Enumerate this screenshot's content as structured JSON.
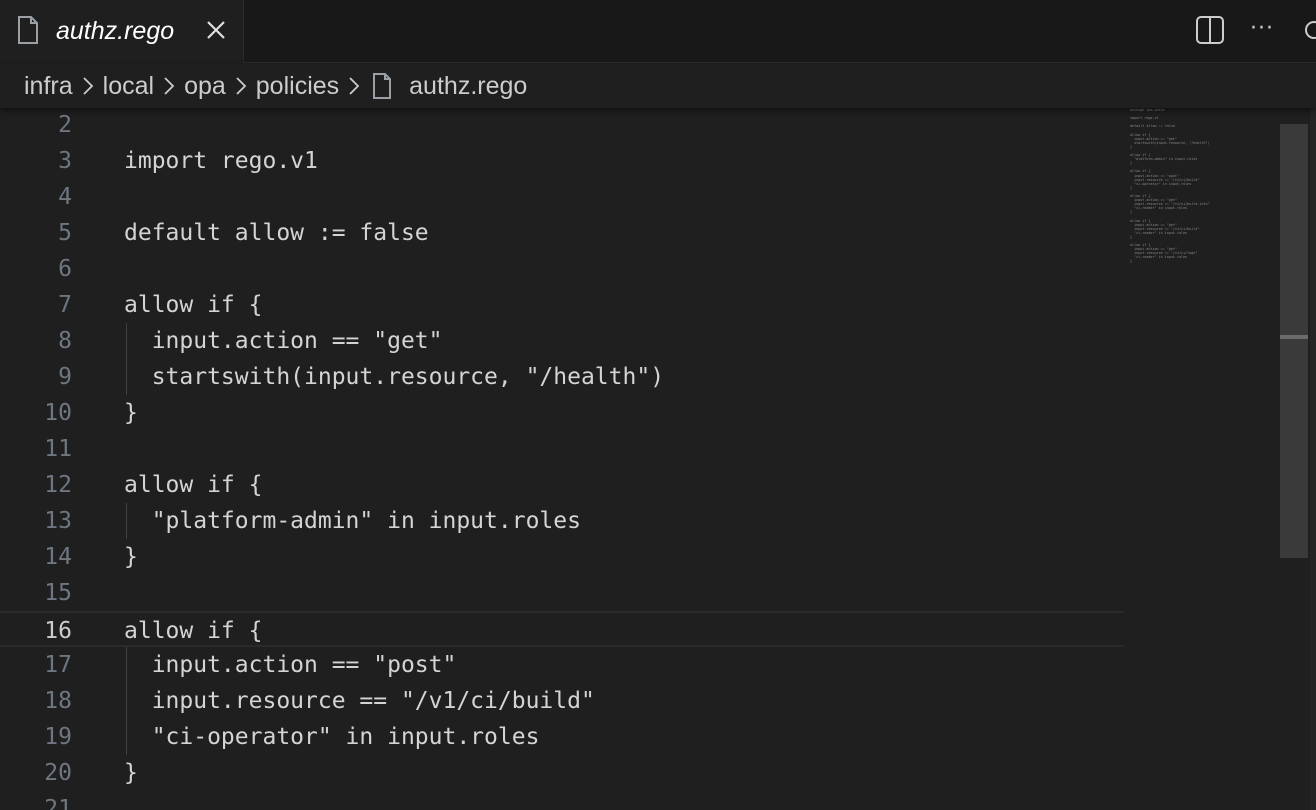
{
  "tab": {
    "label": "authz.rego",
    "icon": "file-icon"
  },
  "breadcrumb": {
    "items": [
      "infra",
      "local",
      "opa",
      "policies"
    ],
    "file": "authz.rego"
  },
  "editor": {
    "current_line": "16",
    "lines": [
      {
        "num": "2",
        "text": ""
      },
      {
        "num": "3",
        "text": "import rego.v1"
      },
      {
        "num": "4",
        "text": ""
      },
      {
        "num": "5",
        "text": "default allow := false"
      },
      {
        "num": "6",
        "text": ""
      },
      {
        "num": "7",
        "text": "allow if {"
      },
      {
        "num": "8",
        "text": "  input.action == \"get\""
      },
      {
        "num": "9",
        "text": "  startswith(input.resource, \"/health\")"
      },
      {
        "num": "10",
        "text": "}"
      },
      {
        "num": "11",
        "text": ""
      },
      {
        "num": "12",
        "text": "allow if {"
      },
      {
        "num": "13",
        "text": "  \"platform-admin\" in input.roles"
      },
      {
        "num": "14",
        "text": "}"
      },
      {
        "num": "15",
        "text": ""
      },
      {
        "num": "16",
        "text": "allow if {"
      },
      {
        "num": "17",
        "text": "  input.action == \"post\""
      },
      {
        "num": "18",
        "text": "  input.resource == \"/v1/ci/build\""
      },
      {
        "num": "19",
        "text": "  \"ci-operator\" in input.roles"
      },
      {
        "num": "20",
        "text": "}"
      },
      {
        "num": "21",
        "text": ""
      }
    ]
  },
  "minimap": {
    "text": "package opa.authz\n\nimport rego.v1\n\ndefault allow := false\n\nallow if {\n  input.action == \"get\"\n  startswith(input.resource, \"/health\")\n}\n\nallow if {\n  \"platform-admin\" in input.roles\n}\n\nallow if {\n  input.action == \"post\"\n  input.resource == \"/v1/ci/build\"\n  \"ci-operator\" in input.roles\n}\n\nallow if {\n  input.action == \"get\"\n  input.resource == \"/v1/ci/build-info\"\n  \"ci-reader\" in input.roles\n}\n\nallow if {\n  input.action == \"get\"\n  input.resource == \"/v1/ci/build\"\n  \"ci-reader\" in input.roles\n}\n\nallow if {\n  input.action == \"get\"\n  input.resource == \"/v1/ci/logs\"\n  \"ci-reader\" in input.roles\n}"
  },
  "colors": {
    "background": "#1f1f1f",
    "tabbar": "#181818",
    "text": "#d4d4d4",
    "line_number": "#6e7681"
  }
}
